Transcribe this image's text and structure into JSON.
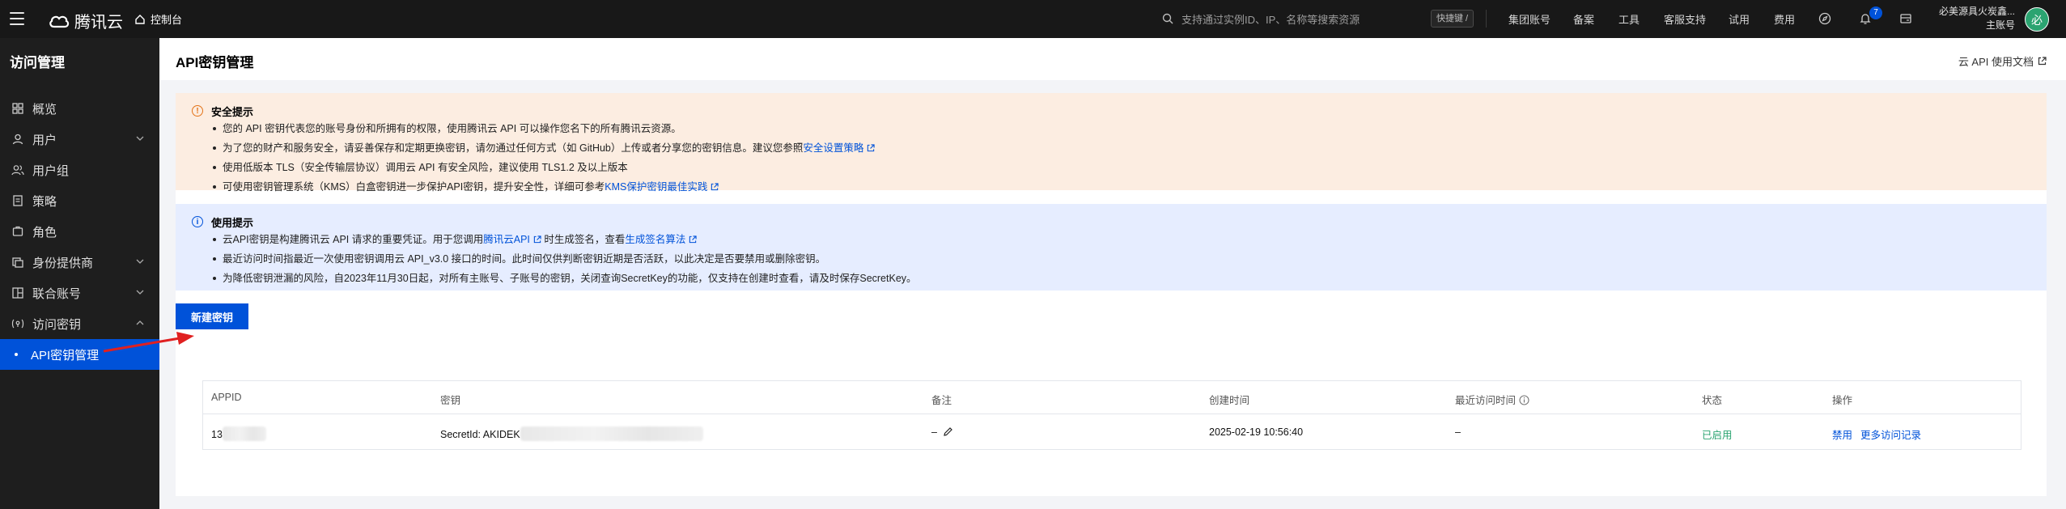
{
  "topbar": {
    "logo_text": "腾讯云",
    "console_label": "控制台",
    "search_placeholder": "支持通过实例ID、IP、名称等搜索资源",
    "shortcut_label": "快捷键 /",
    "nav": [
      "集团账号",
      "备案",
      "工具",
      "客服支持",
      "试用",
      "费用"
    ],
    "notification_count": "7",
    "user_name": "必美源具火炭鑫...",
    "user_role": "主账号",
    "avatar_text": "必"
  },
  "sidebar": {
    "title": "访问管理",
    "items": [
      {
        "label": "概览",
        "icon": "grid-icon"
      },
      {
        "label": "用户",
        "icon": "user-icon",
        "expandable": true
      },
      {
        "label": "用户组",
        "icon": "user-group-icon"
      },
      {
        "label": "策略",
        "icon": "policy-icon"
      },
      {
        "label": "角色",
        "icon": "role-icon"
      },
      {
        "label": "身份提供商",
        "icon": "identity-provider-icon",
        "expandable": true
      },
      {
        "label": "联合账号",
        "icon": "federated-account-icon",
        "expandable": true
      },
      {
        "label": "访问密钥",
        "icon": "key-icon",
        "expandable": true,
        "expanded": true
      }
    ],
    "active_subitem": "API密钥管理"
  },
  "page": {
    "title": "API密钥管理",
    "doc_link": "云 API 使用文档"
  },
  "security_notice": {
    "title": "安全提示",
    "items": [
      {
        "text": "您的 API 密钥代表您的账号身份和所拥有的权限，使用腾讯云 API 可以操作您名下的所有腾讯云资源。"
      },
      {
        "text": "为了您的财产和服务安全，请妥善保存和定期更换密钥，请勿通过任何方式（如 GitHub）上传或者分享您的密钥信息。建议您参照",
        "link": "安全设置策略"
      },
      {
        "text": "使用低版本 TLS（安全传输层协议）调用云 API 有安全风险，建议使用 TLS1.2 及以上版本"
      },
      {
        "text": "可使用密钥管理系统（KMS）白盒密钥进一步保护API密钥，提升安全性，详细可参考",
        "link": "KMS保护密钥最佳实践"
      }
    ]
  },
  "usage_notice": {
    "title": "使用提示",
    "line1_pre": "云API密钥是构建腾讯云 API 请求的重要凭证。用于您调用",
    "line1_link1": "腾讯云API",
    "line1_mid": "时生成签名，查看",
    "line1_link2": "生成签名算法",
    "line2": "最近访问时间指最近一次使用密钥调用云 API_v3.0 接口的时间。此时间仅供判断密钥近期是否活跃，以此决定是否要禁用或删除密钥。",
    "line3": "为降低密钥泄漏的风险，自2023年11月30日起，对所有主账号、子账号的密钥，关闭查询SecretKey的功能，仅支持在创建时查看，请及时保存SecretKey。"
  },
  "create_button": "新建密钥",
  "table": {
    "headers": [
      "APPID",
      "密钥",
      "备注",
      "创建时间",
      "最近访问时间",
      "状态",
      "操作"
    ],
    "rows": [
      {
        "appid": "13",
        "secret": "SecretId: AKIDEK",
        "note": "–",
        "created": "2025-02-19 10:56:40",
        "last_access": "–",
        "status": "已启用",
        "actions": [
          "禁用",
          "更多访问记录"
        ]
      }
    ]
  },
  "colors": {
    "brand": "#0052d9",
    "topbar_bg": "#181818",
    "sidebar_bg": "#1e1e1e",
    "warn_bg": "#fcede1",
    "info_bg": "#e6edff",
    "success": "#2ba471",
    "annotation_arrow": "#e02020"
  }
}
